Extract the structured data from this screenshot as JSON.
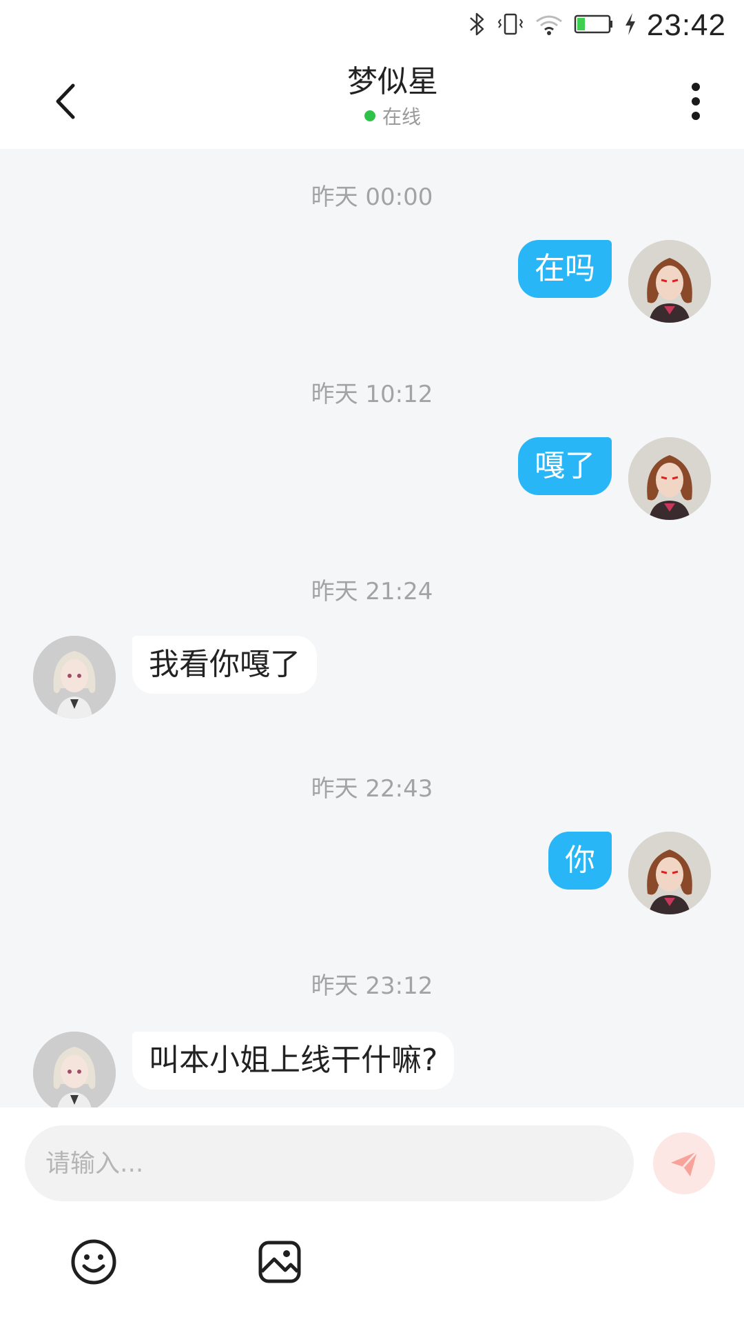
{
  "status_bar": {
    "time": "23:42",
    "icons": [
      "bluetooth-icon",
      "vibrate-icon",
      "wifi-icon",
      "battery-icon",
      "charging-icon"
    ],
    "battery_level": 0.25
  },
  "header": {
    "title": "梦似星",
    "status_text": "在线",
    "status_color": "#2ec24a",
    "back_icon": "chevron-left-icon",
    "more_icon": "more-vertical-icon"
  },
  "messages": [
    {
      "time": "昨天 00:00",
      "sender": "self",
      "text": "在吗"
    },
    {
      "time": "昨天 10:12",
      "sender": "self",
      "text": "嘎了"
    },
    {
      "time": "昨天 21:24",
      "sender": "other",
      "text": "我看你嘎了"
    },
    {
      "time": "昨天 22:43",
      "sender": "self",
      "text": "你"
    },
    {
      "time": "昨天 23:12",
      "sender": "other",
      "text": "叫本小姐上线干什嘛?"
    }
  ],
  "colors": {
    "self_bubble": "#29b6f6",
    "other_bubble": "#ffffff",
    "chat_background": "#f4f6f8",
    "send_button": "#fde7e5",
    "send_icon": "#f8a29a"
  },
  "input": {
    "placeholder": "请输入...",
    "value": ""
  },
  "toolbar": {
    "emoji_icon": "emoji-smile-icon",
    "image_icon": "image-icon",
    "send_icon": "send-icon"
  }
}
